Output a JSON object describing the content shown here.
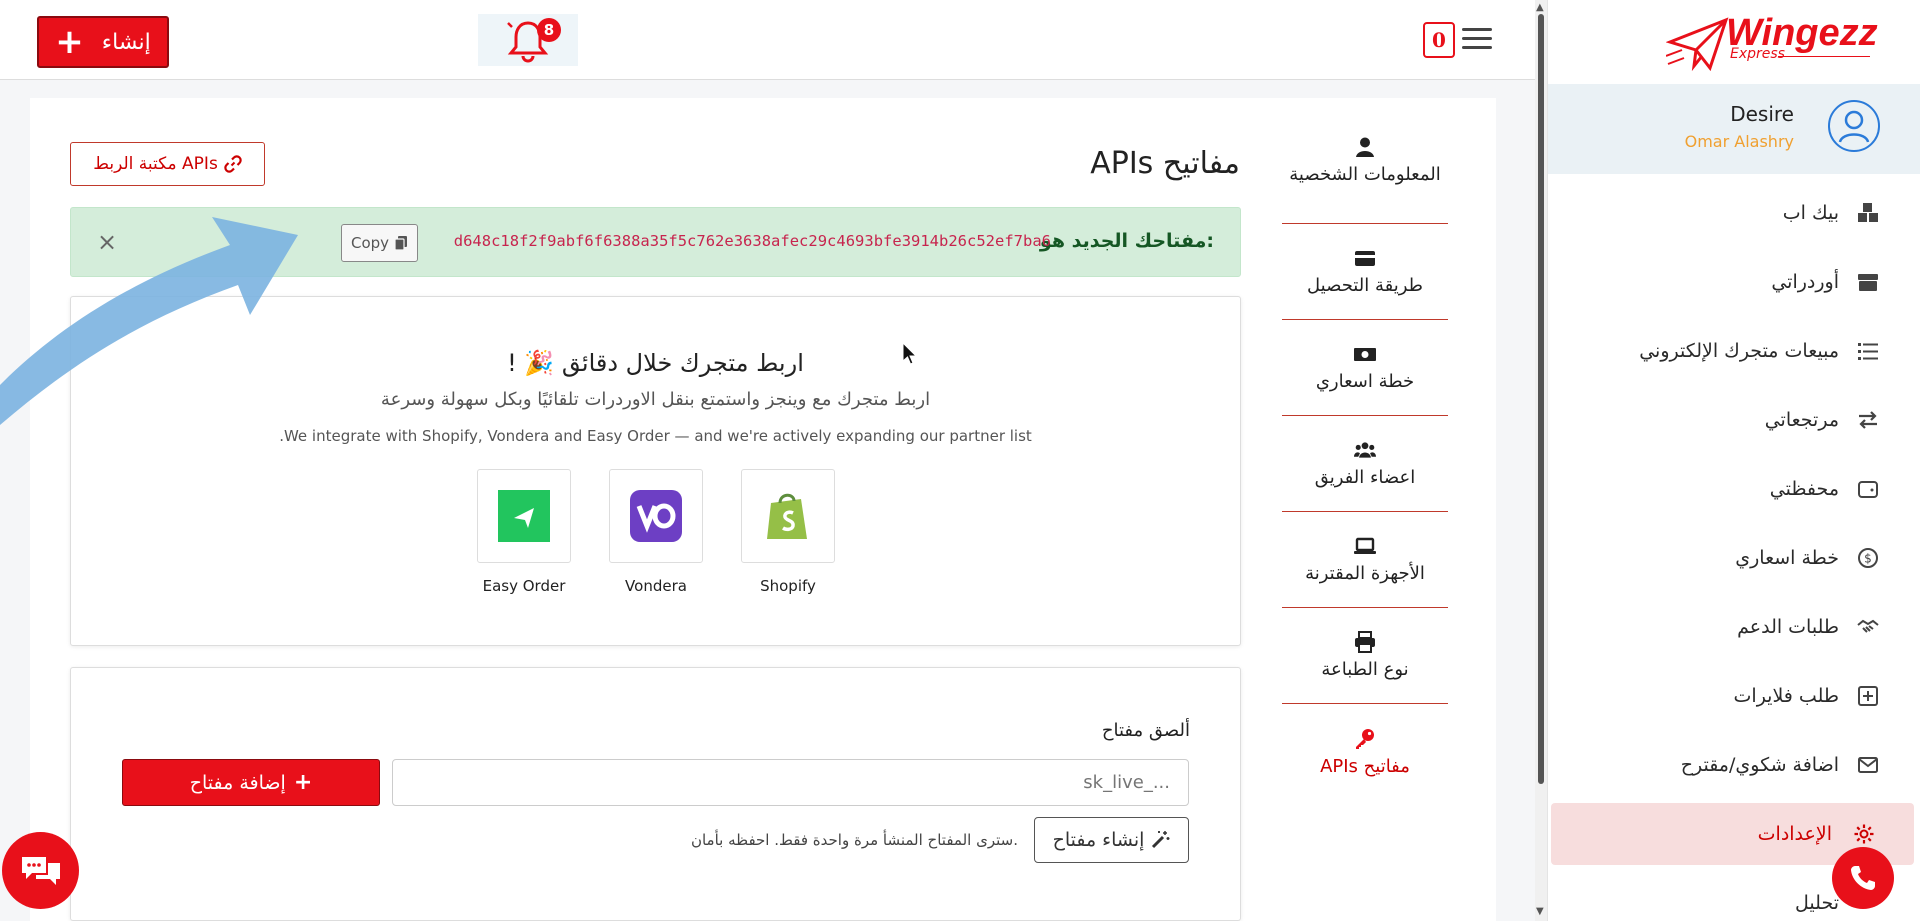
{
  "topbar": {
    "create_label": "إنشاء",
    "notification_count": "8",
    "cart_count": "0"
  },
  "sidebar": {
    "logo_text": "Wingezz",
    "logo_sub": "Express",
    "user_name": "Desire",
    "user_sub": "Omar Alashry",
    "items": [
      {
        "label": "بيك اب",
        "icon": "boxes-icon"
      },
      {
        "label": "أوردراتي",
        "icon": "box-icon"
      },
      {
        "label": "مبيعات متجرك الإلكتروني",
        "icon": "list-icon"
      },
      {
        "label": "مرتجعاتي",
        "icon": "exchange-icon"
      },
      {
        "label": "محفظتي",
        "icon": "wallet-icon"
      },
      {
        "label": "خطة اسعاري",
        "icon": "dollar-circle-icon"
      },
      {
        "label": "طلبات الدعم",
        "icon": "handshake-icon"
      },
      {
        "label": "طلب فلايرات",
        "icon": "plus-square-icon"
      },
      {
        "label": "اضافة شكوي/مقترح",
        "icon": "envelope-icon"
      },
      {
        "label": "الإعدادات",
        "icon": "gear-icon"
      },
      {
        "label": "تحليل",
        "icon": "chart-icon"
      }
    ],
    "active_index": 9
  },
  "settings_menu": [
    {
      "label": "المعلومات الشخصية",
      "icon": "user-icon"
    },
    {
      "label": "طريقة التحصيل",
      "icon": "credit-card-icon"
    },
    {
      "label": "خطة اسعاري",
      "icon": "money-bill-icon"
    },
    {
      "label": "اعضاء الفريق",
      "icon": "users-icon"
    },
    {
      "label": "الأجهزة المقترنة",
      "icon": "laptop-icon"
    },
    {
      "label": "نوع الطباعة",
      "icon": "printer-icon"
    },
    {
      "label": "APIs مفاتيح",
      "icon": "key-icon"
    }
  ],
  "main": {
    "page_title": "APIs مفاتيح",
    "library_button": "مكتبة الربط APIs",
    "alert": {
      "label": "مفتاحك الجديد هو:",
      "key": "d648c18f2f9abf6f6388a35f5c762e3638afec29c4693bfe3914b26c52ef7ba6",
      "copy_label": "Copy"
    },
    "connect": {
      "title": "اربط متجرك خلال دقائق 🎉 !",
      "subtitle": "اربط متجرك مع وينجز واستمتع بنقل الاوردرات تلقائيًا وبكل سهولة وسرعة",
      "english_note": ".We integrate with Shopify, Vondera and Easy Order — and we're actively expanding our partner list",
      "partners": [
        {
          "name": "Easy Order",
          "color": "#22c55e"
        },
        {
          "name": "Vondera",
          "color": "#6d3fc4"
        },
        {
          "name": "Shopify",
          "color": "#95bf47"
        }
      ]
    },
    "key_form": {
      "label": "ألصق مفتاح",
      "placeholder": "sk_live_...",
      "add_button": "إضافة مفتاح",
      "generate_button": "إنشاء مفتاح",
      "note": "سترى المفتاح المنشأ مرة واحدة فقط. احفظه بأمان."
    }
  },
  "colors": {
    "brand": "#e8101a",
    "alert_bg": "#d4edda",
    "active_bg": "#f7dddd"
  }
}
